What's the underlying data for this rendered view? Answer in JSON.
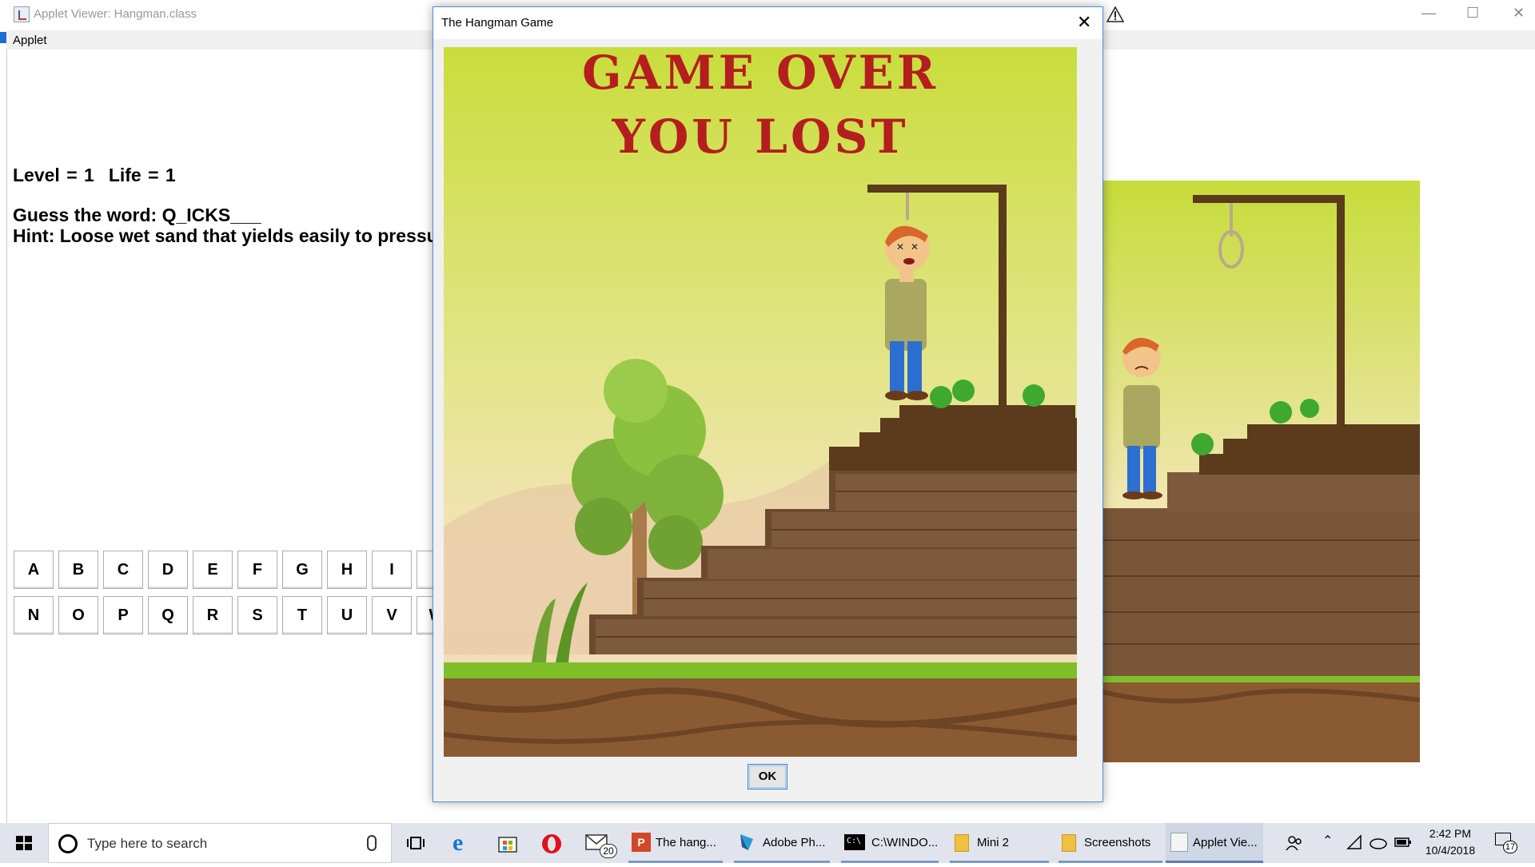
{
  "applet_window": {
    "title": "Applet Viewer: Hangman.class",
    "menu": "Applet",
    "level_label": "Level = 1",
    "life_label": "Life = 1",
    "guess_label": "Guess the word: Q_ICKS___",
    "hint_label": "Hint: Loose wet sand that yields easily to pressu",
    "keyboard_row1": [
      "A",
      "B",
      "C",
      "D",
      "E",
      "F",
      "G",
      "H",
      "I",
      ""
    ],
    "keyboard_row2": [
      "N",
      "O",
      "P",
      "Q",
      "R",
      "S",
      "T",
      "U",
      "V",
      "W"
    ],
    "window_controls": [
      "—",
      "☐",
      "✕"
    ]
  },
  "dialog": {
    "title": "The Hangman Game",
    "close": "✕",
    "message_line1": "GAME OVER",
    "message_line2": "YOU LOST",
    "ok_label": "OK",
    "colors": {
      "message": "#b41e1e",
      "sky_top": "#c9dd3c",
      "wood": "#6b4a2e",
      "grass": "#7fbf2a",
      "dirt": "#8a5a33"
    }
  },
  "taskbar": {
    "search_placeholder": "Type here to search",
    "mail_badge": "20",
    "apps": [
      {
        "name": "powerpoint-icon",
        "label": "The hang..."
      },
      {
        "name": "photoshop-icon",
        "label": "Adobe Ph..."
      },
      {
        "name": "cmd-icon",
        "label": "C:\\WINDO..."
      },
      {
        "name": "folder-icon",
        "label": "Mini 2"
      },
      {
        "name": "folder-icon",
        "label": "Screenshots"
      },
      {
        "name": "java-icon",
        "label": "Applet Vie..."
      }
    ],
    "time": "2:42 PM",
    "date": "10/4/2018",
    "notification_count": "17"
  }
}
